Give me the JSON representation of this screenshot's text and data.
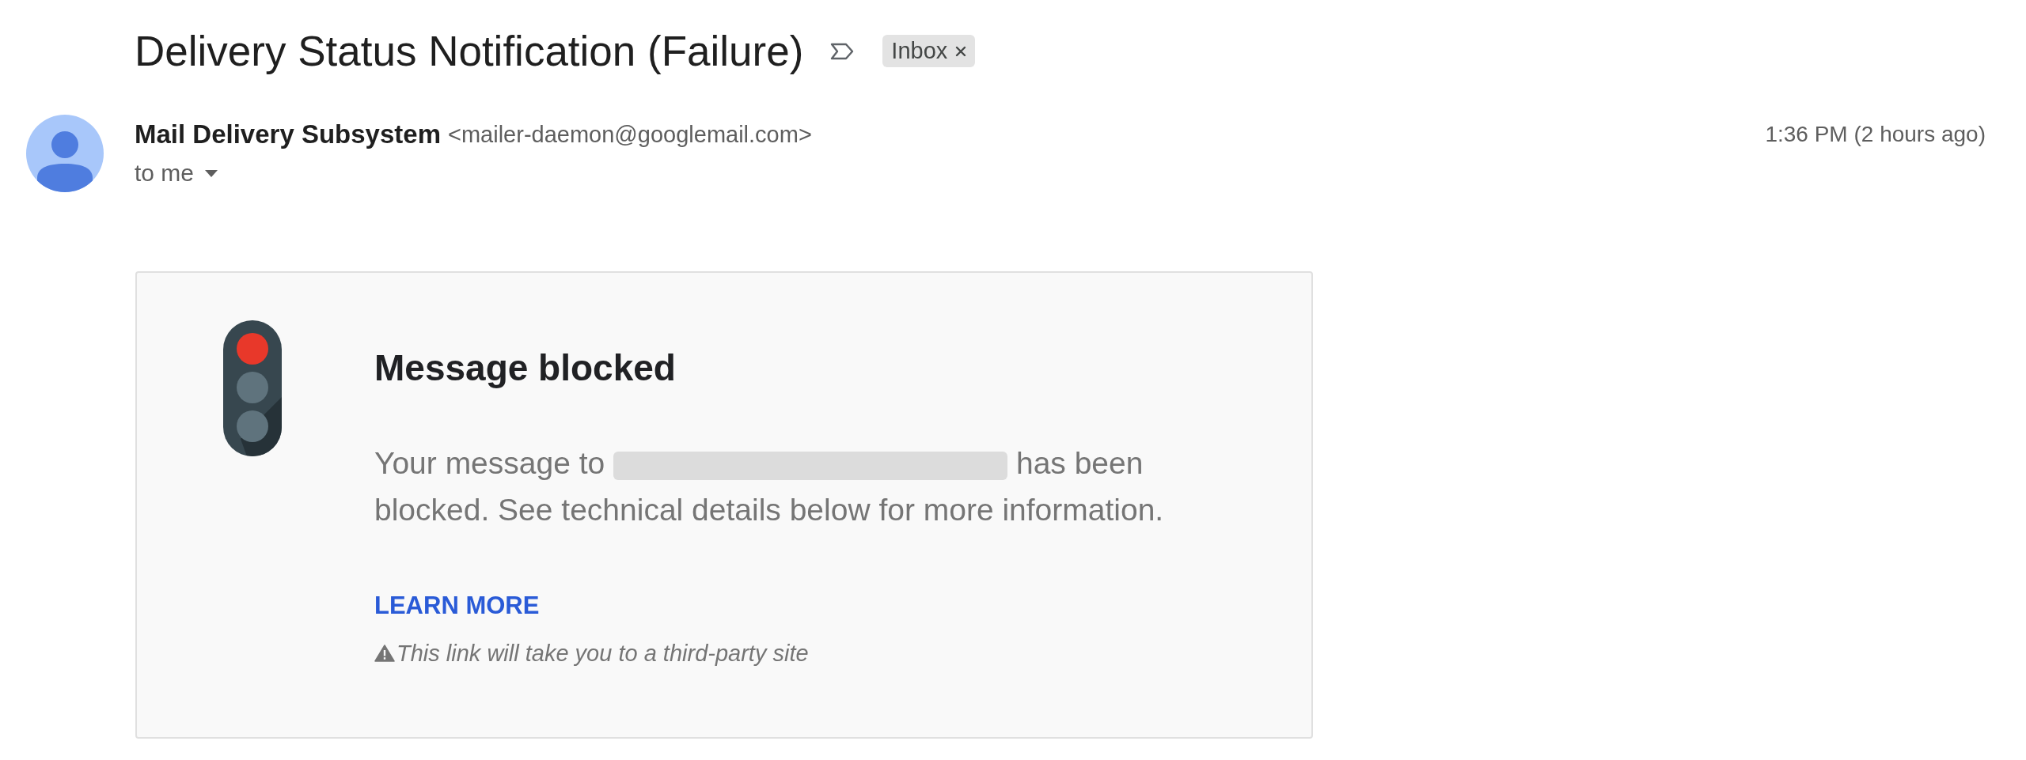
{
  "email": {
    "subject": "Delivery Status Notification (Failure)",
    "important": false,
    "labels": [
      {
        "name": "Inbox",
        "removable": true
      }
    ]
  },
  "message": {
    "sender_name": "Mail Delivery Subsystem",
    "sender_email": "<mailer-daemon@googlemail.com>",
    "recipient": "to me",
    "time": "1:36 PM (2 hours ago)"
  },
  "notice": {
    "kind": "stop",
    "heading": "Message blocked",
    "body_before": "Your message to",
    "recipient_redacted": true,
    "body_after": "has been blocked. See technical details below for more information.",
    "link": "LEARN MORE",
    "warning": "This link will take you to a third-party site"
  }
}
